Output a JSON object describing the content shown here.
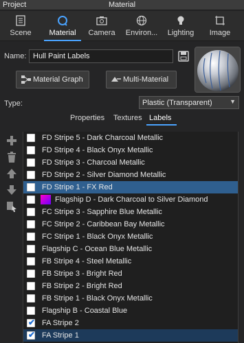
{
  "window": {
    "project_label": "Project",
    "title": "Material"
  },
  "tabs": [
    {
      "label": "Scene",
      "icon": "scene-icon"
    },
    {
      "label": "Material",
      "icon": "material-sphere-icon"
    },
    {
      "label": "Camera",
      "icon": "camera-icon"
    },
    {
      "label": "Environ...",
      "icon": "globe-icon"
    },
    {
      "label": "Lighting",
      "icon": "lightbulb-icon"
    },
    {
      "label": "Image",
      "icon": "image-crop-icon"
    }
  ],
  "active_tab": "Material",
  "name_field": {
    "label": "Name:",
    "value": "Hull Paint Labels"
  },
  "buttons": {
    "material_graph": "Material Graph",
    "multi_material": "Multi-Material"
  },
  "type_field": {
    "label": "Type:",
    "value": "Plastic (Transparent)"
  },
  "subtabs": [
    "Properties",
    "Textures",
    "Labels"
  ],
  "active_subtab": "Labels",
  "side_tools": [
    "add-icon",
    "delete-icon",
    "move-up-icon",
    "move-down-icon",
    "select-icon"
  ],
  "labels": [
    {
      "text": "FD Stripe 5 - Dark Charcoal Metallic",
      "checked": false
    },
    {
      "text": "FD Stripe 4 - Black Onyx Metallic",
      "checked": false
    },
    {
      "text": "FD Stripe 3 - Charcoal Metallic",
      "checked": false
    },
    {
      "text": "FD Stripe 2 - Silver Diamond Metallic",
      "checked": false
    },
    {
      "text": "FD Stripe 1 - FX Red",
      "checked": false,
      "selected": true
    },
    {
      "text": "Flagship D - Dark Charcoal to Silver Diamond",
      "checked": false,
      "swatch": true
    },
    {
      "text": "FC Stripe 3 - Sapphire Blue Metallic",
      "checked": false
    },
    {
      "text": "FC Stripe 2 - Caribbean Bay Metallic",
      "checked": false
    },
    {
      "text": "FC Stripe 1 - Black Onyx Metallic",
      "checked": false
    },
    {
      "text": "Flagship C - Ocean Blue Metallic",
      "checked": false
    },
    {
      "text": "FB Stripe 4 - Steel  Metallic",
      "checked": false
    },
    {
      "text": "FB Stripe 3 - Bright Red",
      "checked": false
    },
    {
      "text": "FB Stripe 2 - Bright Red",
      "checked": false
    },
    {
      "text": "FB Stripe 1 - Black Onyx Metallic",
      "checked": false
    },
    {
      "text": "Flagship B - Coastal Blue",
      "checked": false
    },
    {
      "text": "FA Stripe 2",
      "checked": true
    },
    {
      "text": "FA Stripe 1",
      "checked": true
    }
  ],
  "colors": {
    "accent": "#4aa3ff",
    "selected_row": "#2f5f8f",
    "background": "#252526"
  }
}
